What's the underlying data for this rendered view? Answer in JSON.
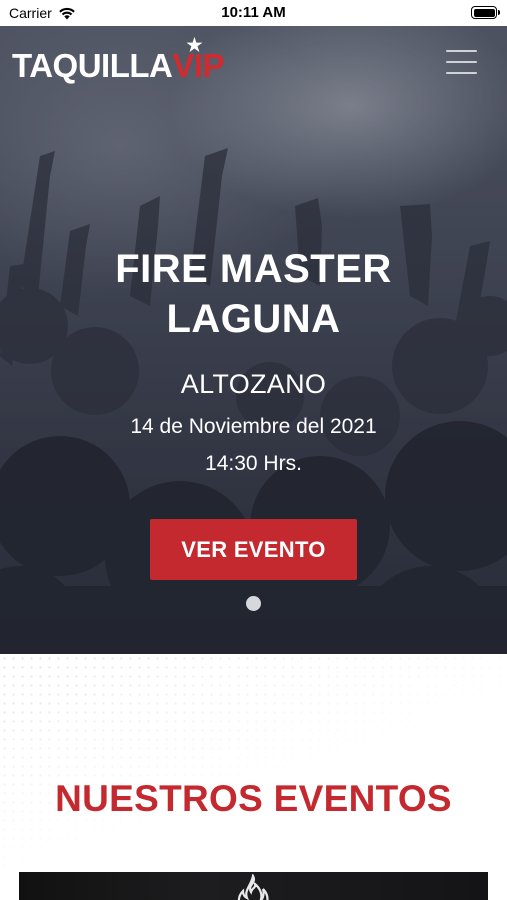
{
  "status_bar": {
    "carrier": "Carrier",
    "time": "10:11 AM",
    "wifi_icon": "wifi-icon",
    "battery_icon": "battery-icon"
  },
  "header": {
    "logo_main": "TAQUILLA",
    "logo_accent": "VIP",
    "logo_star": "★",
    "menu_icon": "hamburger-menu-icon"
  },
  "hero": {
    "title_line1": "FIRE MASTER",
    "title_line2": "LAGUNA",
    "venue": "ALTOZANO",
    "date": "14 de Noviembre del 2021",
    "time": "14:30 Hrs.",
    "cta_label": "VER EVENTO",
    "carousel_dots": 1,
    "active_dot": 0
  },
  "events_section": {
    "title": "NUESTROS EVENTOS",
    "card_icon": "flame-icon"
  },
  "colors": {
    "brand_red": "#c4292f",
    "hero_text": "#ffffff",
    "section_title": "#c4292f"
  }
}
